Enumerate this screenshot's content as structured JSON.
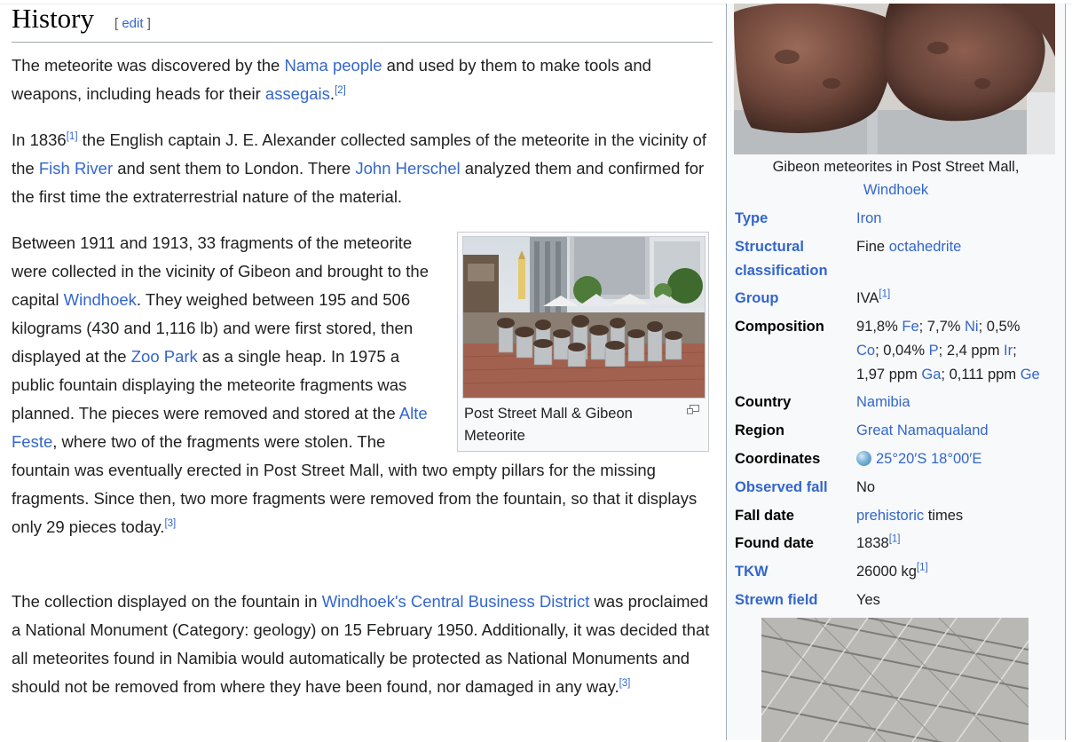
{
  "section": {
    "title": "History",
    "edit_open": "[ ",
    "edit_label": "edit",
    "edit_close": " ]"
  },
  "p1": {
    "t1": "The meteorite was discovered by the ",
    "l1": "Nama people",
    "t2": " and used by them to make tools and weapons, including heads for their ",
    "l2": "assegais",
    "t3": ".",
    "r1": "[2]"
  },
  "p2": {
    "t1": "In 1836",
    "r1": "[1]",
    "t2": " the English captain J. E. Alexander collected samples of the meteorite in the vicinity of the ",
    "l1": "Fish River",
    "t3": " and sent them to London. There ",
    "l2": "John Herschel",
    "t4": " analyzed them and confirmed for the first time the extraterrestrial nature of the material."
  },
  "p3": {
    "t1": "Between 1911 and 1913, 33 fragments of the meteorite were collected in the vicinity of Gibeon and brought to the capital ",
    "l1": "Windhoek",
    "t2": ". They weighed between 195 and 506 kilograms (430 and 1,116 lb) and were first stored, then displayed at the ",
    "l2": "Zoo Park",
    "t3": " as a single heap. In 1975 a public fountain displaying the meteorite fragments was planned. The pieces were removed and stored at the ",
    "l3": "Alte Feste",
    "t4": ", where two of the fragments were stolen. The fountain was eventually erected in Post Street Mall, with two empty pillars for the missing fragments. Since then, two more fragments were removed from the fountain, so that it displays only 29 pieces today.",
    "r1": "[3]"
  },
  "p4": {
    "t1": "The collection displayed on the fountain in ",
    "l1": "Windhoek's Central Business District",
    "t2": " was proclaimed a National Monument (Category: geology) on 15 February 1950. Additionally, it was decided that all meteorites found in Namibia would automatically be protected as National Monuments and should not be removed from where they have been found, nor damaged in any way.",
    "r1": "[3]"
  },
  "thumb": {
    "caption": "Post Street Mall & Gibeon Meteorite"
  },
  "infobox": {
    "caption_text": "Gibeon meteorites in Post Street Mall,",
    "caption_link": "Windhoek",
    "rows": {
      "type": {
        "label": "Type",
        "value": "Iron"
      },
      "structural": {
        "label": "Structural classification",
        "value_prefix": "Fine ",
        "value_link": "octahedrite"
      },
      "group": {
        "label": "Group",
        "value": "IVA",
        "ref": "[1]"
      },
      "composition": {
        "label": "Composition",
        "a": "91,8% ",
        "fe": "Fe",
        "b": "; 7,7% ",
        "ni": "Ni",
        "c": "; 0,5% ",
        "co": "Co",
        "d": "; 0,04% ",
        "p": "P",
        "e": "; 2,4 ppm ",
        "ir": "Ir",
        "f": ";",
        "g": "1,97 ppm ",
        "ga": "Ga",
        "h": "; 0,111 ppm ",
        "ge": "Ge"
      },
      "country": {
        "label": "Country",
        "value": "Namibia"
      },
      "region": {
        "label": "Region",
        "value": "Great Namaqualand"
      },
      "coordinates": {
        "label": "Coordinates",
        "value": "25°20′S 18°00′E"
      },
      "observed": {
        "label": "Observed fall",
        "value": "No"
      },
      "falldate": {
        "label": "Fall date",
        "value_link": "prehistoric",
        "value_suffix": " times"
      },
      "founddate": {
        "label": "Found date",
        "value": "1838",
        "ref": "[1]"
      },
      "tkw": {
        "label": "TKW",
        "value": "26000 kg",
        "ref": "[1]"
      },
      "strewn": {
        "label": "Strewn field",
        "value": "Yes"
      }
    }
  },
  "colors": {
    "link": "#3366cc",
    "text": "#202122",
    "infobox_bg": "#f8f9fa",
    "border": "#a2a9b1"
  }
}
